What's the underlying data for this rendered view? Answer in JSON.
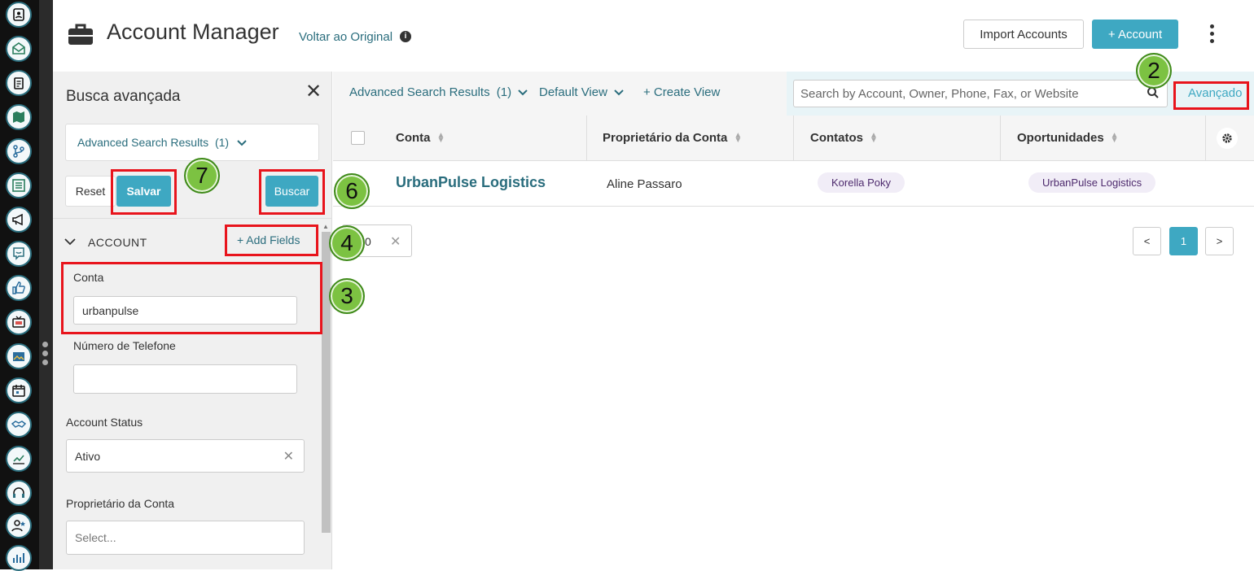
{
  "header": {
    "title": "Account Manager",
    "back_link": "Voltar ao Original",
    "import_label": "Import Accounts",
    "add_label": "+ Account"
  },
  "rail": {
    "icons": [
      "contacts-icon",
      "mail-icon",
      "clipboard-icon",
      "map-icon",
      "branch-icon",
      "list-icon",
      "megaphone-icon",
      "chat-icon",
      "thumbs-up-icon",
      "tv-icon",
      "gallery-icon",
      "calendar-icon",
      "handshake-icon",
      "chart-icon",
      "headset-icon",
      "user-star-icon",
      "bar-chart-icon"
    ]
  },
  "panel": {
    "title": "Busca avançada",
    "select_value": "Advanced Search Results",
    "select_count": "(1)",
    "reset_label": "Reset",
    "save_label": "Salvar",
    "search_label": "Buscar",
    "section_title": "ACCOUNT",
    "add_fields": "+ Add Fields",
    "fields": {
      "conta_label": "Conta",
      "conta_value": "urbanpulse",
      "phone_label": "Número de Telefone",
      "phone_value": "",
      "status_label": "Account Status",
      "status_value": "Ativo",
      "owner_label": "Proprietário da Conta",
      "owner_placeholder": "Select..."
    }
  },
  "viewbar": {
    "results_label": "Advanced Search Results",
    "results_count": "(1)",
    "default_view": "Default View",
    "create_view": "+ Create View",
    "search_placeholder": "Search by Account, Owner, Phone, Fax, or Website",
    "advanced_label": "Avançado"
  },
  "table": {
    "columns": [
      "Conta",
      "Proprietário da Conta",
      "Contatos",
      "Oportunidades"
    ],
    "rows": [
      {
        "conta": "UrbanPulse Logistics",
        "owner": "Aline Passaro",
        "contact": "Korella Poky",
        "opportunity": "UrbanPulse Logistics"
      }
    ]
  },
  "pagination": {
    "per_page": "0",
    "prev": "<",
    "current": "1",
    "next": ">"
  },
  "annotations": {
    "step2": "2",
    "step3": "3",
    "step4": "4",
    "step6": "6",
    "step7": "7"
  },
  "colors": {
    "accent": "#3ea8c2",
    "link": "#2a6d7d",
    "highlight": "#e8141c",
    "step_badge": "#7cc242"
  }
}
